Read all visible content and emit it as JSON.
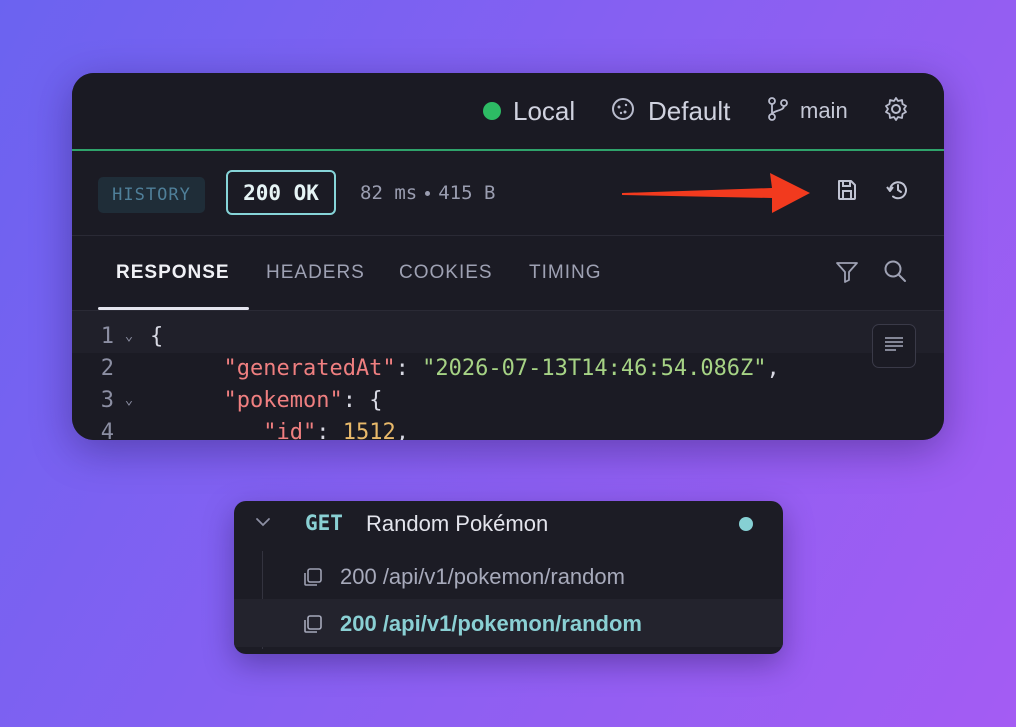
{
  "topbar": {
    "environment": "Local",
    "cookie_jar": "Default",
    "branch": "main"
  },
  "response_status": {
    "history_badge": "HISTORY",
    "status": "200 OK",
    "time": "82 ms",
    "size": "415 B"
  },
  "tabs": [
    {
      "label": "RESPONSE",
      "active": true
    },
    {
      "label": "HEADERS"
    },
    {
      "label": "COOKIES"
    },
    {
      "label": "TIMING"
    }
  ],
  "editor": {
    "lines": [
      {
        "num": "1",
        "text": "{"
      },
      {
        "num": "2",
        "key": "\"generatedAt\"",
        "value": "\"2026-07-13T14:46:54.086Z\""
      },
      {
        "num": "3",
        "key": "\"pokemon\"",
        "open": "{"
      },
      {
        "num": "4",
        "key": "\"id\"",
        "value": "1512"
      }
    ]
  },
  "request_tree": {
    "method": "GET",
    "name": "Random Pokémon",
    "history": [
      {
        "label": "200 /api/v1/pokemon/random"
      },
      {
        "label": "200 /api/v1/pokemon/random",
        "selected": true
      }
    ]
  },
  "colors": {
    "status_border": "#86d4d8",
    "env_dot": "#2dbb64",
    "accent_teal": "#8ad0d4",
    "arrow": "#f23a1e"
  },
  "icons": [
    "cookie-icon",
    "git-branch-icon",
    "gear-icon",
    "save-icon",
    "history-icon",
    "filter-icon",
    "search-icon",
    "wrap-lines-icon",
    "chevron-down-icon",
    "copy-icon"
  ]
}
